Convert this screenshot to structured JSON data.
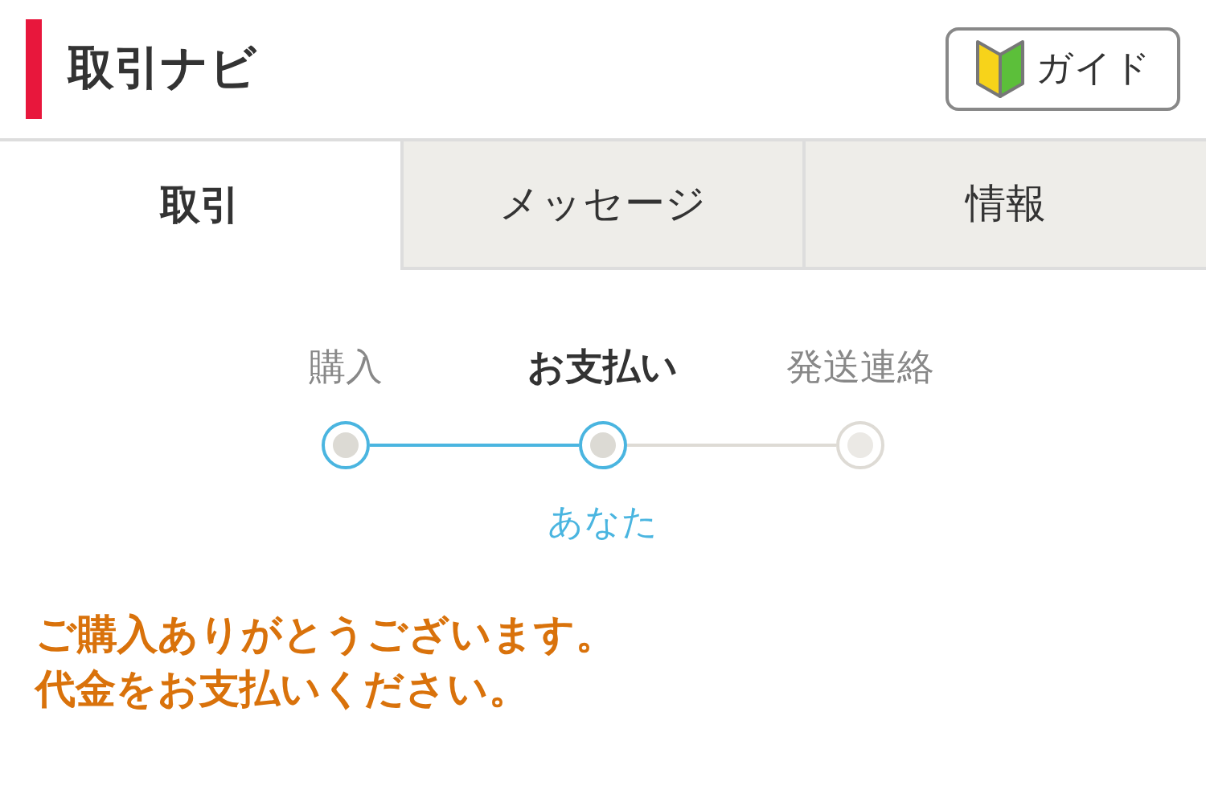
{
  "header": {
    "title": "取引ナビ",
    "guide_button": "ガイド"
  },
  "tabs": [
    {
      "label": "取引",
      "selected": true
    },
    {
      "label": "メッセージ",
      "selected": false
    },
    {
      "label": "情報",
      "selected": false
    }
  ],
  "steps": [
    {
      "label": "購入",
      "reached": true,
      "selected": false
    },
    {
      "label": "お支払い",
      "reached": true,
      "selected": true,
      "actor": "あなた"
    },
    {
      "label": "発送連絡",
      "reached": false,
      "selected": false
    }
  ],
  "message": [
    "ご購入ありがとうございます。",
    "代金をお支払いください。"
  ]
}
